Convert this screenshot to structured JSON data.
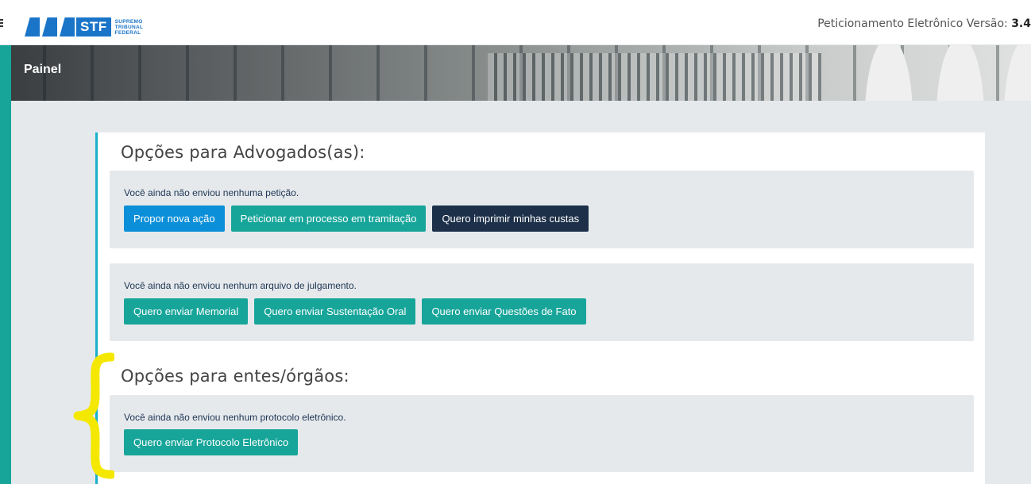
{
  "header": {
    "logo": {
      "acronym": "STF",
      "line1": "SUPREMO",
      "line2": "TRIBUNAL",
      "line3": "FEDERAL",
      "color": "#1a75c9"
    },
    "version_label": "Peticionamento Eletrônico Versão: ",
    "version_value": "3.4"
  },
  "banner": {
    "title": "Painel"
  },
  "colors": {
    "teal": "#17a59a",
    "blue": "#0b8fd8",
    "navy": "#1d3049",
    "accent_border": "#1ab0c9",
    "annotation": "#f5e800"
  },
  "sections": {
    "advogados": {
      "title": "Opções para Advogados(as):",
      "peticao": {
        "text": "Você ainda não enviou nenhuma petição.",
        "buttons": [
          "Propor nova ação",
          "Peticionar em processo em tramitação",
          "Quero imprimir minhas custas"
        ]
      },
      "julgamento": {
        "text": "Você ainda não enviou nenhum arquivo de julgamento.",
        "buttons": [
          "Quero enviar Memorial",
          "Quero enviar Sustentação Oral",
          "Quero enviar Questões de Fato"
        ]
      }
    },
    "entes": {
      "title": "Opções para entes/órgãos:",
      "protocolo": {
        "text": "Você ainda não enviou nenhum protocolo eletrônico.",
        "buttons": [
          "Quero enviar Protocolo Eletrônico"
        ]
      }
    }
  }
}
